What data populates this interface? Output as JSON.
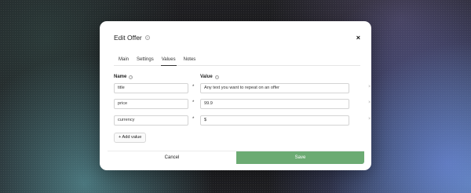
{
  "modal": {
    "title": "Edit Offer",
    "help_icon": "?",
    "close_icon": "×"
  },
  "tabs": [
    {
      "label": "Main",
      "active": false
    },
    {
      "label": "Settings",
      "active": false
    },
    {
      "label": "Values",
      "active": true
    },
    {
      "label": "Notes",
      "active": false
    }
  ],
  "columns": {
    "name": "Name",
    "value": "Value"
  },
  "rows": [
    {
      "name": "title",
      "required": "*",
      "value": "Any text you want to repeat on an offer",
      "remove": "×"
    },
    {
      "name": "price",
      "required": "*",
      "value": "99.9",
      "remove": "×"
    },
    {
      "name": "currency",
      "required": "*",
      "value": "$",
      "remove": "×"
    }
  ],
  "add_value_label": "+ Add value",
  "footer": {
    "cancel_label": "Cancel",
    "save_label": "Save"
  },
  "colors": {
    "save_button": "#6cab73"
  }
}
